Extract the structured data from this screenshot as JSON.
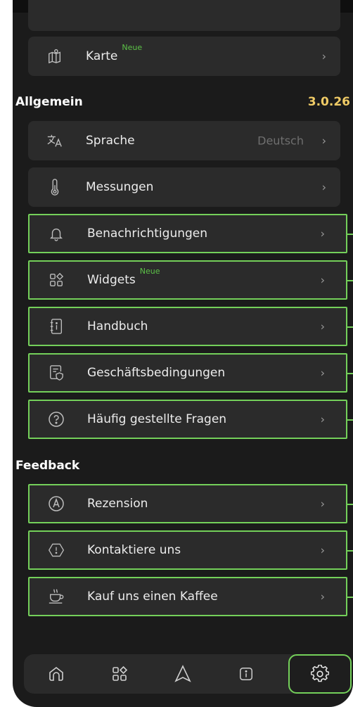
{
  "menu": {
    "karte": {
      "label": "Karte",
      "badge": "Neue"
    }
  },
  "general": {
    "title": "Allgemein",
    "version": "3.0.26",
    "items": [
      {
        "label": "Sprache",
        "value": "Deutsch",
        "icon": "translate-icon"
      },
      {
        "label": "Messungen",
        "icon": "thermometer-icon"
      },
      {
        "label": "Benachrichtigungen",
        "icon": "bell-icon"
      },
      {
        "label": "Widgets",
        "badge": "Neue",
        "icon": "widgets-icon"
      },
      {
        "label": "Handbuch",
        "icon": "manual-icon"
      },
      {
        "label": "Geschäftsbedingungen",
        "icon": "terms-icon"
      },
      {
        "label": "Häufig gestellte Fragen",
        "icon": "question-icon"
      }
    ]
  },
  "feedback": {
    "title": "Feedback",
    "items": [
      {
        "label": "Rezension",
        "icon": "review-icon"
      },
      {
        "label": "Kontaktiere uns",
        "icon": "alert-hexagon-icon"
      },
      {
        "label": "Kauf uns einen Kaffee",
        "icon": "coffee-icon"
      }
    ]
  },
  "chevron": "›",
  "tabbar": {
    "tabs": [
      "home-icon",
      "widgets-icon",
      "navigation-icon",
      "info-icon",
      "settings-icon"
    ],
    "active": "settings-icon"
  },
  "colors": {
    "background": "#1b1b1b",
    "card": "#2b2b2b",
    "highlight": "#74d05a",
    "badge": "#5cc247",
    "version": "#f0cb66"
  }
}
